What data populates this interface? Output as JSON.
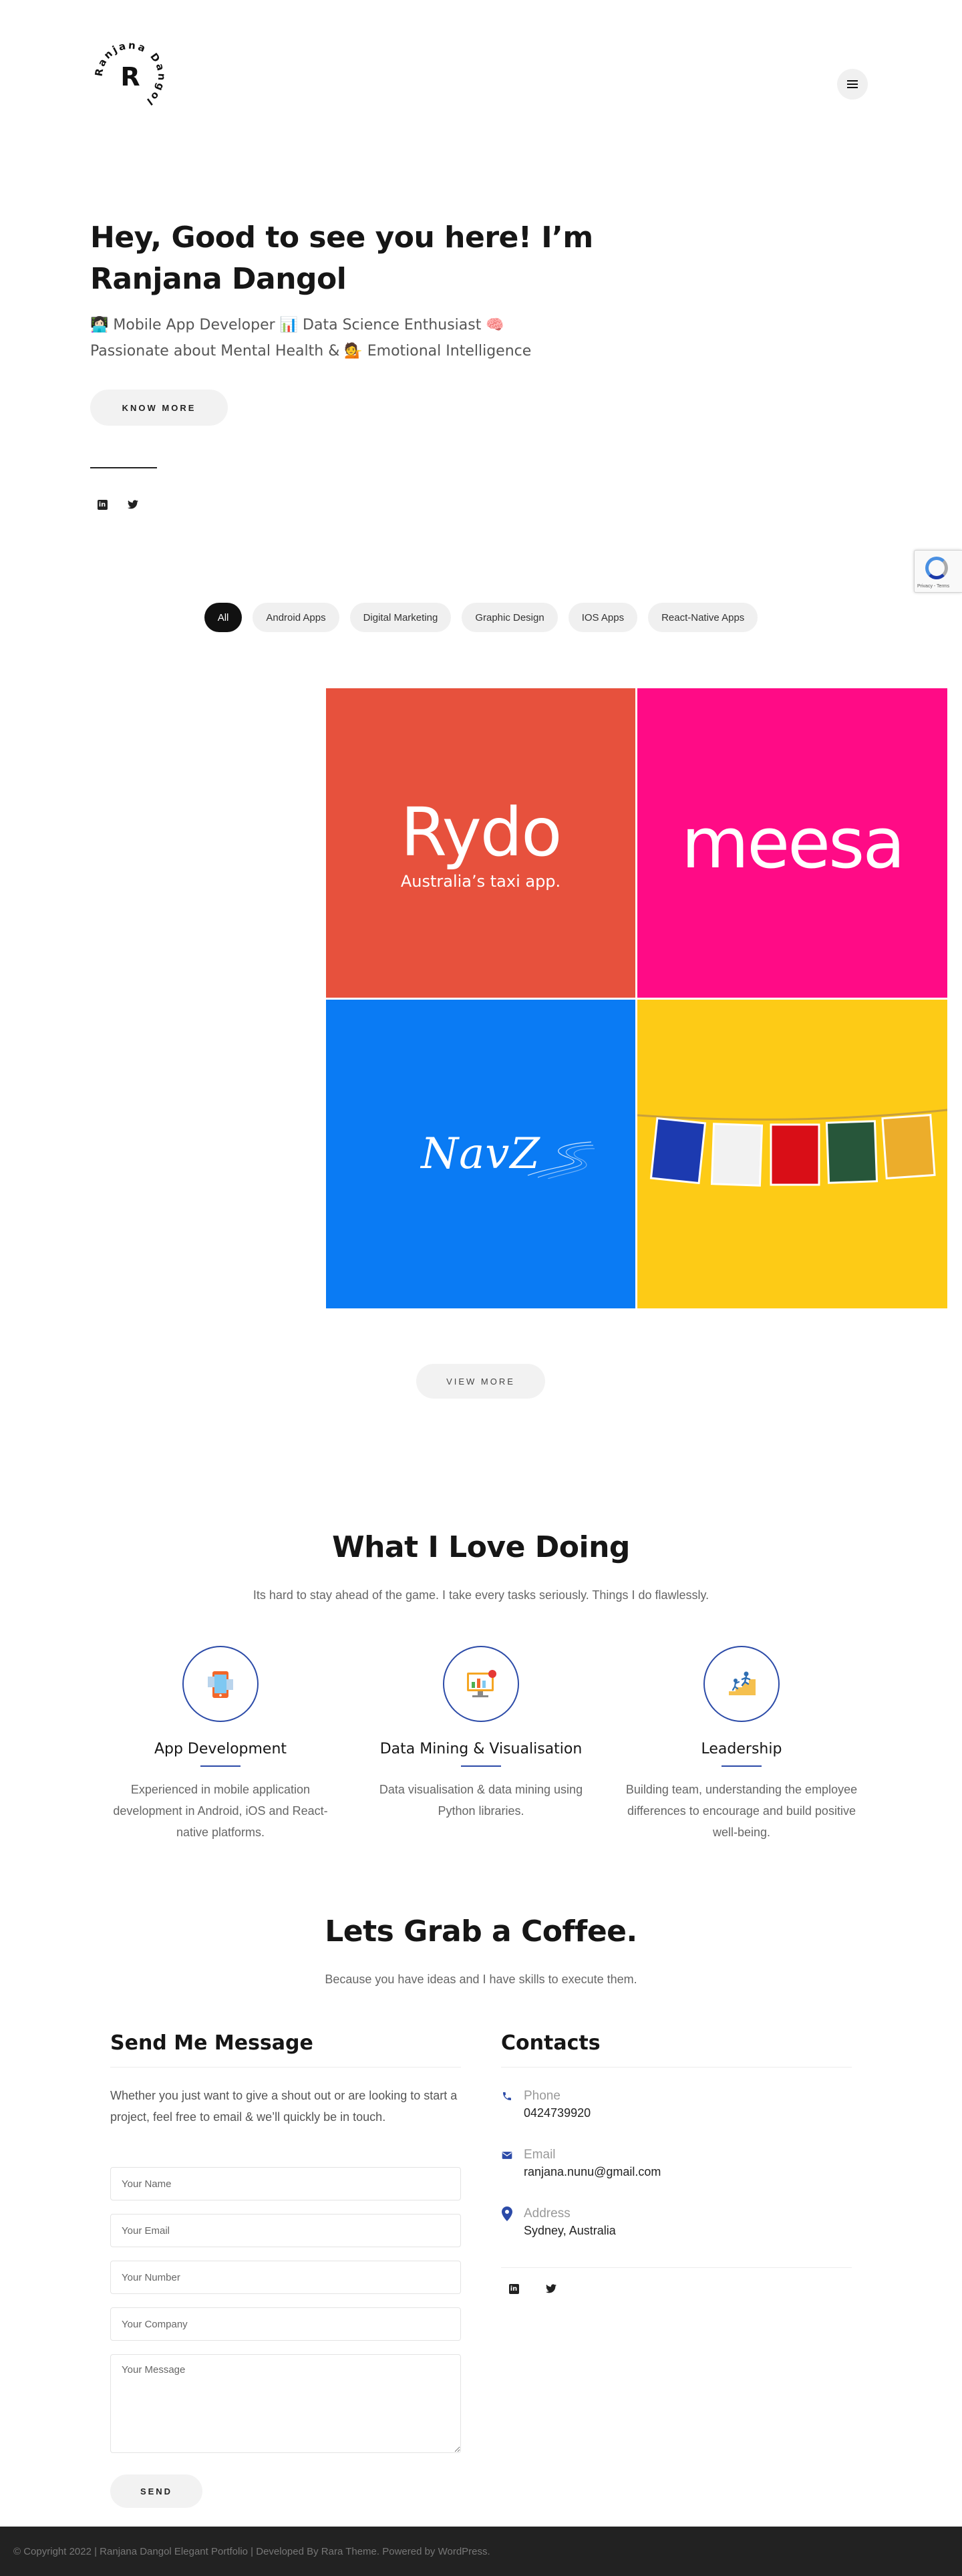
{
  "brand": {
    "logo_letter": "R",
    "logo_ring_text": "Ranjana Dangol"
  },
  "hero": {
    "title": "Hey, Good to see you here! I’m Ranjana Dangol",
    "subtitle_line1": "👩🏻‍💻 Mobile App Developer 📊 Data Science Enthusiast 🧠",
    "subtitle_line2": "Passionate about Mental Health & 💁 Emotional Intelligence",
    "cta_label": "KNOW MORE"
  },
  "recaptcha": {
    "text": "Privacy - Terms"
  },
  "filters": [
    "All",
    "Android Apps",
    "Digital Marketing",
    "Graphic Design",
    "IOS Apps",
    "React-Native Apps"
  ],
  "portfolio": {
    "rydo": {
      "name": "Rydo",
      "tagline": "Australia’s taxi app.",
      "color": "#e7513d"
    },
    "meesa": {
      "name": "meesa",
      "color": "#ff0b86"
    },
    "navz": {
      "name": "NavZ",
      "color": "#0a7bf4"
    },
    "flags": {
      "color": "#fdcb16",
      "flag_colors": [
        "#1c3ab0",
        "#f2f2f2",
        "#d90e17",
        "#27563a",
        "#ecad2b"
      ]
    }
  },
  "view_more_label": "VIEW MORE",
  "services": {
    "title": "What I Love Doing",
    "subtitle": "Its hard to stay ahead of the game. I take every tasks seriously. Things I do flawlessly.",
    "items": [
      {
        "title": "App Development",
        "desc": "Experienced in mobile application development in Android, iOS and React-native platforms.",
        "icon": "mobile-app-icon"
      },
      {
        "title": "Data Mining & Visualisation",
        "desc": "Data visualisation & data mining using Python libraries.",
        "icon": "data-visualisation-icon"
      },
      {
        "title": "Leadership",
        "desc": "Building team, understanding the employee differences to encourage and build positive well-being.",
        "icon": "leadership-icon"
      }
    ]
  },
  "contact": {
    "title": "Lets Grab a Coffee.",
    "subtitle": "Because you have ideas and I have skills to execute them.",
    "form": {
      "heading": "Send Me Message",
      "intro": "Whether you just want to give a shout out or are looking to start a project, feel free to email & we’ll quickly be in touch.",
      "name_placeholder": "Your Name",
      "email_placeholder": "Your Email",
      "number_placeholder": "Your Number",
      "company_placeholder": "Your Company",
      "message_placeholder": "Your Message",
      "send_label": "SEND"
    },
    "info": {
      "heading": "Contacts",
      "phone_label": "Phone",
      "phone": "0424739920",
      "email_label": "Email",
      "email": "ranjana.nunu@gmail.com",
      "address_label": "Address",
      "address": "Sydney, Australia"
    }
  },
  "footer": {
    "text": "© Copyright 2022 | Ranjana Dangol Elegant Portfolio | Developed By Rara Theme. Powered by WordPress."
  },
  "colors": {
    "accent": "#2c4ba8",
    "dark": "#161616",
    "chip_bg": "#f0f0f0",
    "footer_bg": "#222222"
  }
}
